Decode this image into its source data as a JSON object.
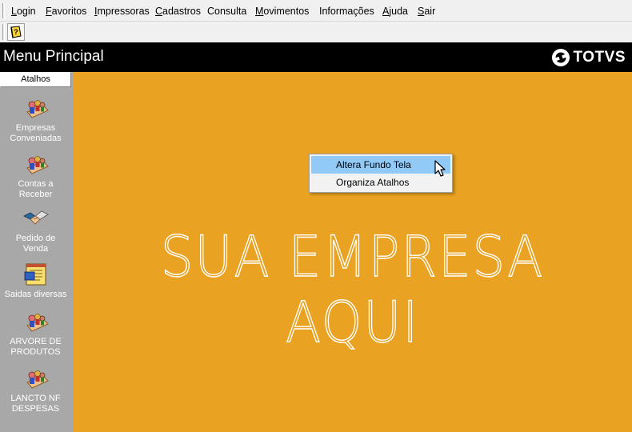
{
  "menubar": {
    "items": [
      {
        "label": "Login",
        "accel": "L",
        "rest": "ogin"
      },
      {
        "label": "Favoritos",
        "accel": "F",
        "rest": "avoritos"
      },
      {
        "label": "Impressoras",
        "accel": "I",
        "rest": "mpressoras"
      },
      {
        "label": "Cadastros",
        "accel": "C",
        "rest": "adastros"
      },
      {
        "label": "Consulta",
        "accel": "",
        "rest": "Consulta"
      },
      {
        "label": "Movimentos",
        "accel": "M",
        "rest": "ovimentos"
      },
      {
        "label": "Informações",
        "accel": "",
        "rest": "Informações"
      },
      {
        "label": "Ajuda",
        "accel": "A",
        "rest": "juda"
      },
      {
        "label": "Sair",
        "accel": "S",
        "rest": "air"
      }
    ]
  },
  "toolbar": {
    "button_icon": "help-book-icon"
  },
  "titlebar": {
    "title": "Menu Principal",
    "logo_text": "TOTVS"
  },
  "sidebar": {
    "header": "Atalhos",
    "shortcuts": [
      {
        "line1": "Empresas",
        "line2": "Conveniadas",
        "icon": "people-group-icon"
      },
      {
        "line1": "Contas a",
        "line2": "Receber",
        "icon": "people-group-icon"
      },
      {
        "line1": "Pedido de",
        "line2": "Venda",
        "icon": "handshake-icon"
      },
      {
        "line1": "Saidas diversas",
        "line2": "",
        "icon": "notepad-icon"
      },
      {
        "line1": "ARVORE DE",
        "line2": "PRODUTOS",
        "icon": "people-group-icon"
      },
      {
        "line1": "LANCTO NF",
        "line2": "DESPESAS",
        "icon": "people-group-icon"
      }
    ]
  },
  "main": {
    "background_color": "#e9a221",
    "placeholder_text": "SUA EMPRESA AQUI"
  },
  "context_menu": {
    "items": [
      {
        "label": "Altera Fundo Tela",
        "highlighted": true
      },
      {
        "label": "Organiza Atalhos",
        "highlighted": false
      }
    ]
  }
}
